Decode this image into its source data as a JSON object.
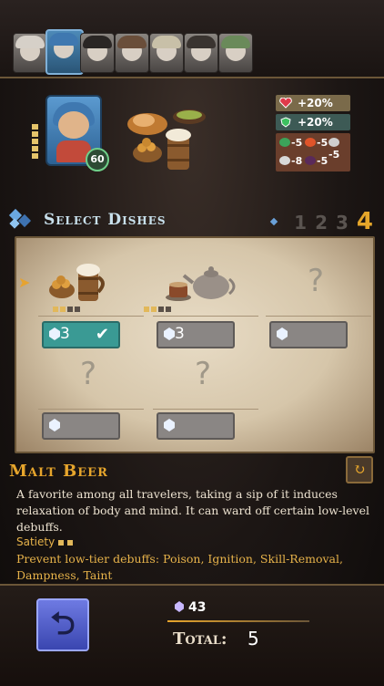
{
  "party": {
    "portraits": [
      {
        "name": "white-fox-portrait",
        "hair": "#d6d0c8",
        "active": false
      },
      {
        "name": "blue-hood-hero-portrait",
        "hair": "#3f78b0",
        "active": true
      },
      {
        "name": "dark-hair-portrait",
        "hair": "#2a2624",
        "active": false
      },
      {
        "name": "brown-hair-portrait",
        "hair": "#6a4e3a",
        "active": false
      },
      {
        "name": "pale-hair-portrait",
        "hair": "#c8c0a8",
        "active": false
      },
      {
        "name": "dark-coat-portrait",
        "hair": "#3a3430",
        "active": false
      },
      {
        "name": "frog-portrait",
        "hair": "#6a8a5a",
        "active": false
      }
    ]
  },
  "hero": {
    "level": "60"
  },
  "buffs": {
    "hp": "+20%",
    "defense": "+20%",
    "resists": [
      {
        "icon": "leaf-icon",
        "value": "-5",
        "color": "#3ca35a"
      },
      {
        "icon": "fire-icon",
        "value": "-5",
        "color": "#e0542a"
      },
      {
        "icon": "spiral-icon",
        "value": "-5",
        "color": "#cfcfcf"
      },
      {
        "icon": "wind-icon",
        "value": "-8",
        "color": "#d8d8d8"
      },
      {
        "icon": "curse-icon",
        "value": "-5",
        "color": "#5a2a5a"
      }
    ]
  },
  "select": {
    "title": "Select Dishes",
    "steps": [
      "1",
      "2",
      "3",
      "4"
    ],
    "current_step": "4"
  },
  "slots": [
    {
      "state": "dish",
      "dish": "malt-beer",
      "cost": "3",
      "selected": true,
      "satiety": [
        1,
        1,
        0,
        0
      ]
    },
    {
      "state": "dish",
      "dish": "tea",
      "cost": "3",
      "selected": false,
      "satiety": [
        1,
        1,
        0,
        0
      ]
    },
    {
      "state": "empty",
      "q": "?"
    },
    {
      "state": "empty",
      "q": "?"
    },
    {
      "state": "empty",
      "q": "?"
    }
  ],
  "detail": {
    "name": "Malt Beer",
    "description": "A favorite among all travelers, taking a sip of it induces relaxation of body and mind. It can ward off certain low-level debuffs.",
    "satiety_label": "Satiety",
    "effect": "Prevent low-tier debuffs: Poison, Ignition, Skill-Removal, Dampness, Taint"
  },
  "footer": {
    "gems": "43",
    "total_label": "Total:",
    "total_value": "5"
  }
}
